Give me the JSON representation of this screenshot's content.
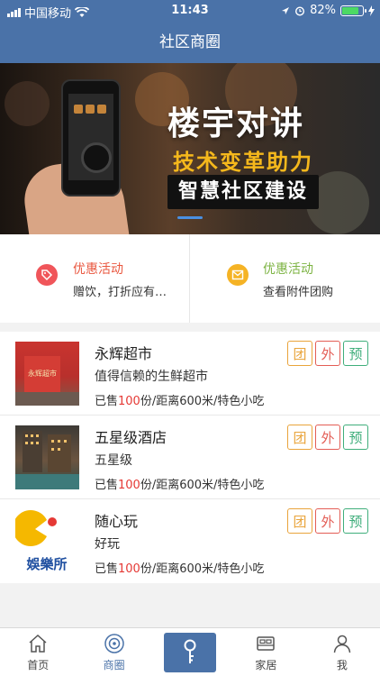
{
  "status_bar": {
    "carrier": "中国移动",
    "time": "11:43",
    "battery": "82%",
    "battery_level": 0.82
  },
  "header": {
    "title": "社区商圈"
  },
  "banner": {
    "headline": "楼宇对讲",
    "subheadline": "技术变革助力",
    "tagline": "智慧社区建设",
    "slide_indicator_active": 1
  },
  "promos": [
    {
      "title": "优惠活动",
      "desc": "赠饮，打折应有…",
      "icon": "tag-icon",
      "color": "#e9573f"
    },
    {
      "title": "优惠活动",
      "desc": "查看附件团购",
      "icon": "envelope-icon",
      "color": "#7cb342"
    }
  ],
  "tags": {
    "group": "团",
    "delivery": "外",
    "reserve": "预"
  },
  "shops": [
    {
      "name": "永辉超市",
      "desc": "值得信赖的生鲜超市",
      "sold_prefix": "已售",
      "sold": "100",
      "sold_suffix": "份/距离600米/特色小吃"
    },
    {
      "name": "五星级酒店",
      "desc": "五星级",
      "sold_prefix": "已售",
      "sold": "100",
      "sold_suffix": "份/距离600米/特色小吃"
    },
    {
      "name": "随心玩",
      "desc": "好玩",
      "sold_prefix": "已售",
      "sold": "100",
      "sold_suffix": "份/距离600米/特色小吃",
      "logo_text": "娛樂所"
    }
  ],
  "tabbar": {
    "items": [
      {
        "label": "首页",
        "icon": "home-icon"
      },
      {
        "label": "商圈",
        "icon": "shopping-district-icon",
        "active": true
      },
      {
        "label": "",
        "icon": "key-icon"
      },
      {
        "label": "家居",
        "icon": "bed-icon"
      },
      {
        "label": "我",
        "icon": "person-icon"
      }
    ]
  }
}
